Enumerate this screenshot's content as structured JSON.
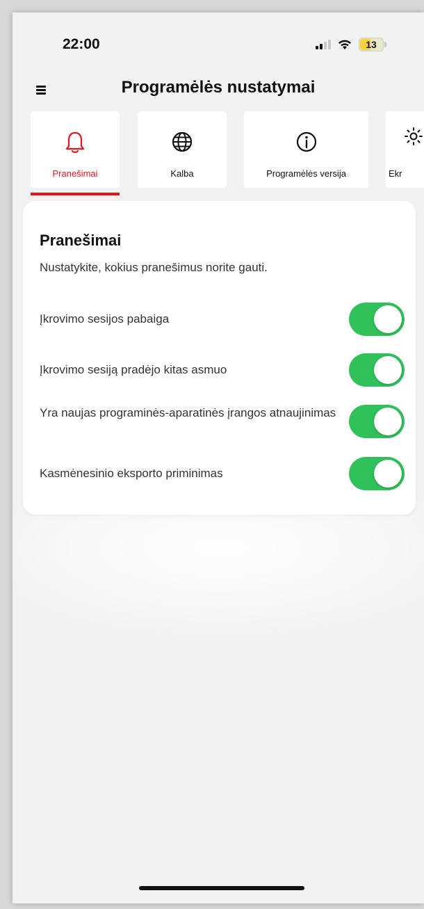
{
  "status_bar": {
    "time": "22:00",
    "battery_level": "13",
    "signal_icon": "cellular-signal-icon",
    "wifi_icon": "wifi-icon"
  },
  "header": {
    "title": "Programėlės nustatymai",
    "menu_icon": "hamburger-menu-icon"
  },
  "tabs": [
    {
      "label": "Pranešimai",
      "icon": "bell-icon",
      "active": true
    },
    {
      "label": "Kalba",
      "icon": "globe-icon",
      "active": false
    },
    {
      "label": "Programėlės versija",
      "icon": "info-circle-icon",
      "active": false
    },
    {
      "label": "Ekr",
      "icon": "sun-icon",
      "active": false
    }
  ],
  "notifications_card": {
    "title": "Pranešimai",
    "description": "Nustatykite, kokius pranešimus norite gauti.",
    "settings": [
      {
        "label": "Įkrovimo sesijos pabaiga",
        "enabled": true
      },
      {
        "label": "Įkrovimo sesiją pradėjo kitas asmuo",
        "enabled": true
      },
      {
        "label": "Yra naujas programinės-aparatinės įrangos atnaujinimas",
        "enabled": true
      },
      {
        "label": "Kasmėnesinio eksporto priminimas",
        "enabled": true
      }
    ]
  },
  "colors": {
    "accent": "#e8121e",
    "toggle_on": "#30c15a",
    "background": "#f2f2f2"
  }
}
